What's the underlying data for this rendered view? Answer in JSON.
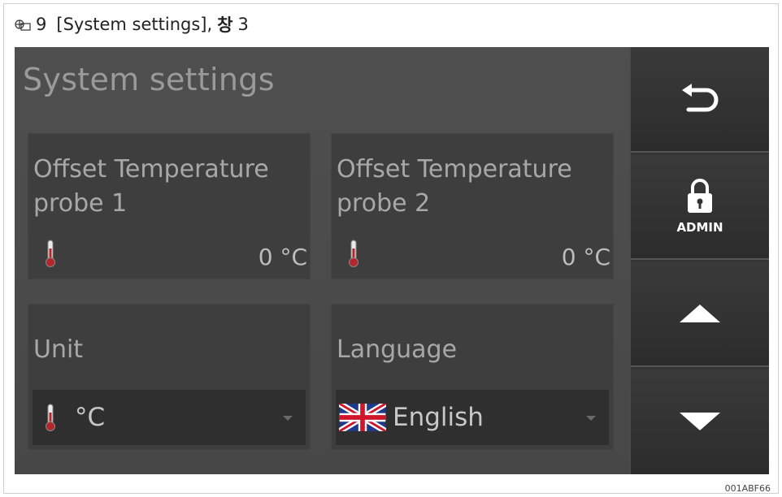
{
  "caption": {
    "figure_number": "9",
    "text": "[System settings],",
    "korean": "창",
    "step": "3"
  },
  "screen": {
    "title": "System settings",
    "tiles": [
      {
        "label": "Offset Temperature probe 1",
        "value": "0 °C",
        "icon": "thermometer-icon"
      },
      {
        "label": "Offset Temperature probe 2",
        "value": "0 °C",
        "icon": "thermometer-icon"
      }
    ],
    "unit": {
      "label": "Unit",
      "selected": "°C",
      "icon": "thermometer-icon"
    },
    "language": {
      "label": "Language",
      "selected": "English",
      "icon": "uk-flag-icon"
    }
  },
  "sidebar": {
    "back_icon": "back-arrow-icon",
    "admin_icon": "padlock-icon",
    "admin_label": "ADMIN",
    "up_icon": "triangle-up-icon",
    "down_icon": "triangle-down-icon"
  },
  "image_code": "001ABF66",
  "colors": {
    "panel_bg": "#4a4a4a",
    "tile_bg": "#3e3e3e",
    "dropdown_bg": "#2f2f2f",
    "sidebar_bg": "#333333",
    "thermometer_red": "#b3262a",
    "text_light": "#ffffff"
  }
}
